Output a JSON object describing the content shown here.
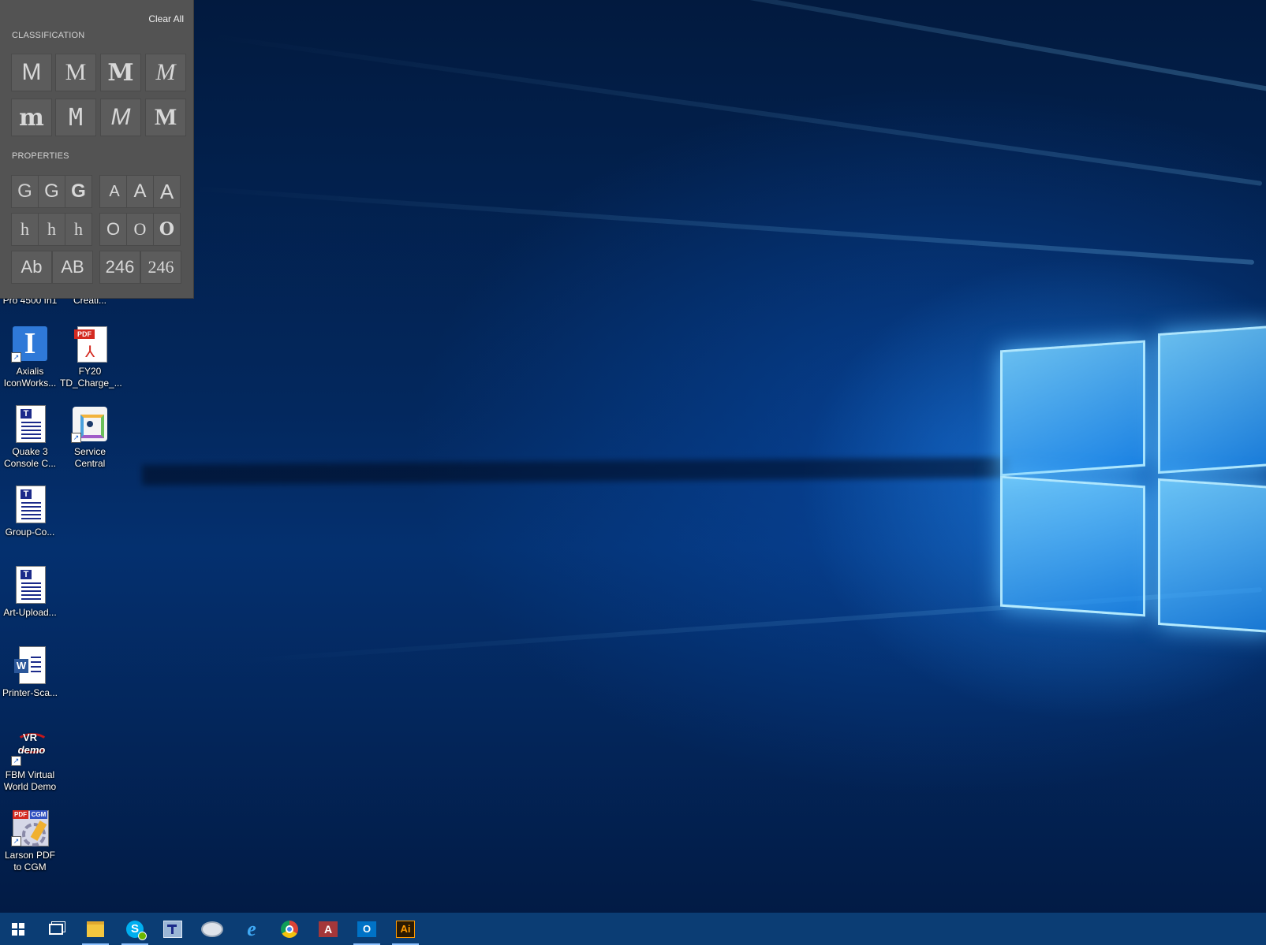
{
  "panel": {
    "clear_all": "Clear All",
    "classification_title": "CLASSIFICATION",
    "properties_title": "PROPERTIES",
    "classification": [
      "M",
      "M",
      "M",
      "M",
      "m",
      "M",
      "M",
      "M"
    ],
    "weight": [
      "G",
      "G",
      "G"
    ],
    "width": [
      "A",
      "A",
      "A"
    ],
    "xheight": [
      "h",
      "h",
      "h"
    ],
    "contrast": [
      "O",
      "O",
      "O"
    ],
    "case": [
      "Ab",
      "AB"
    ],
    "numerals": [
      "246",
      "246"
    ]
  },
  "desktop_icons": [
    {
      "label": "Pro 4500 fn1",
      "icon": "printer-icon"
    },
    {
      "label": "Creati...",
      "icon": "app-icon"
    },
    {
      "label": "Axialis\nIconWorks...",
      "icon": "iconworkshop-icon"
    },
    {
      "label": "FY20\nTD_Charge_...",
      "icon": "pdf-icon"
    },
    {
      "label": "Quake 3\nConsole C...",
      "icon": "text-document-icon"
    },
    {
      "label": "Service\nCentral",
      "icon": "service-central-icon"
    },
    {
      "label": "Group-Co...",
      "icon": "text-document-icon"
    },
    {
      "label": "Art-Upload...",
      "icon": "text-document-icon"
    },
    {
      "label": "Printer-Sca...",
      "icon": "word-document-icon"
    },
    {
      "label": "FBM Virtual\nWorld Demo",
      "icon": "vr-demo-icon",
      "badge": "VR",
      "badge2": "demo"
    },
    {
      "label": "Larson PDF\nto CGM",
      "icon": "pdf-cgm-icon",
      "badge": "PDF",
      "badge2": "CGM"
    }
  ],
  "taskbar": {
    "items": [
      {
        "icon": "windows-start-icon"
      },
      {
        "icon": "task-view-icon"
      },
      {
        "icon": "file-explorer-icon",
        "active": true
      },
      {
        "icon": "skype-icon",
        "active": true
      },
      {
        "icon": "app-pin-icon"
      },
      {
        "icon": "app-pin-2-icon"
      },
      {
        "icon": "internet-explorer-icon"
      },
      {
        "icon": "chrome-icon"
      },
      {
        "icon": "access-icon"
      },
      {
        "icon": "outlook-icon",
        "active": true
      },
      {
        "icon": "illustrator-icon",
        "active": true,
        "text": "Ai"
      }
    ]
  }
}
